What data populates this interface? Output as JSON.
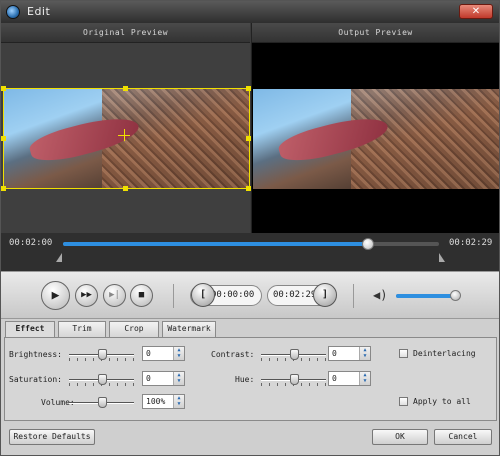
{
  "window": {
    "title": "Edit",
    "close_label": "✕"
  },
  "preview": {
    "original_label": "Original Preview",
    "output_label": "Output Preview"
  },
  "timeline": {
    "start_time": "00:02:00",
    "end_time": "00:02:29",
    "position_fraction": 0.81
  },
  "controls": {
    "trim_start": "00:00:00",
    "trim_end": "00:02:29",
    "volume_fraction": 0.95
  },
  "tabs": [
    "Effect",
    "Trim",
    "Crop",
    "Watermark"
  ],
  "effect": {
    "brightness_label": "Brightness:",
    "brightness_value": "0",
    "contrast_label": "Contrast:",
    "contrast_value": "0",
    "saturation_label": "Saturation:",
    "saturation_value": "0",
    "hue_label": "Hue:",
    "hue_value": "0",
    "volume_label": "Volume:",
    "volume_value": "100%",
    "deinterlacing_label": "Deinterlacing",
    "apply_all_label": "Apply to all"
  },
  "footer": {
    "restore_label": "Restore Defaults",
    "ok_label": "OK",
    "cancel_label": "Cancel"
  }
}
